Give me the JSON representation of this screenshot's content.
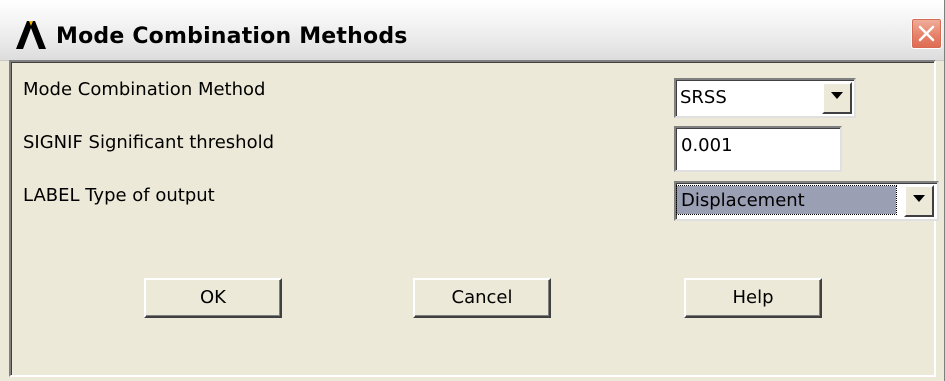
{
  "window": {
    "title": "Mode Combination Methods"
  },
  "fields": {
    "method": {
      "label": "Mode Combination Method",
      "value": "SRSS"
    },
    "threshold": {
      "label": "SIGNIF Significant threshold",
      "value": "0.001"
    },
    "output": {
      "label": "LABEL  Type of output",
      "value": "Displacement"
    }
  },
  "buttons": {
    "ok": "OK",
    "cancel": "Cancel",
    "help": "Help"
  },
  "icons": {
    "app": "ansys-logo-icon",
    "close": "close-icon",
    "dropdown": "triangle-down-icon"
  },
  "colors": {
    "dialog_bg": "#ece9d8",
    "close_button": "#de6b52",
    "selection": "#9b9fb4"
  }
}
